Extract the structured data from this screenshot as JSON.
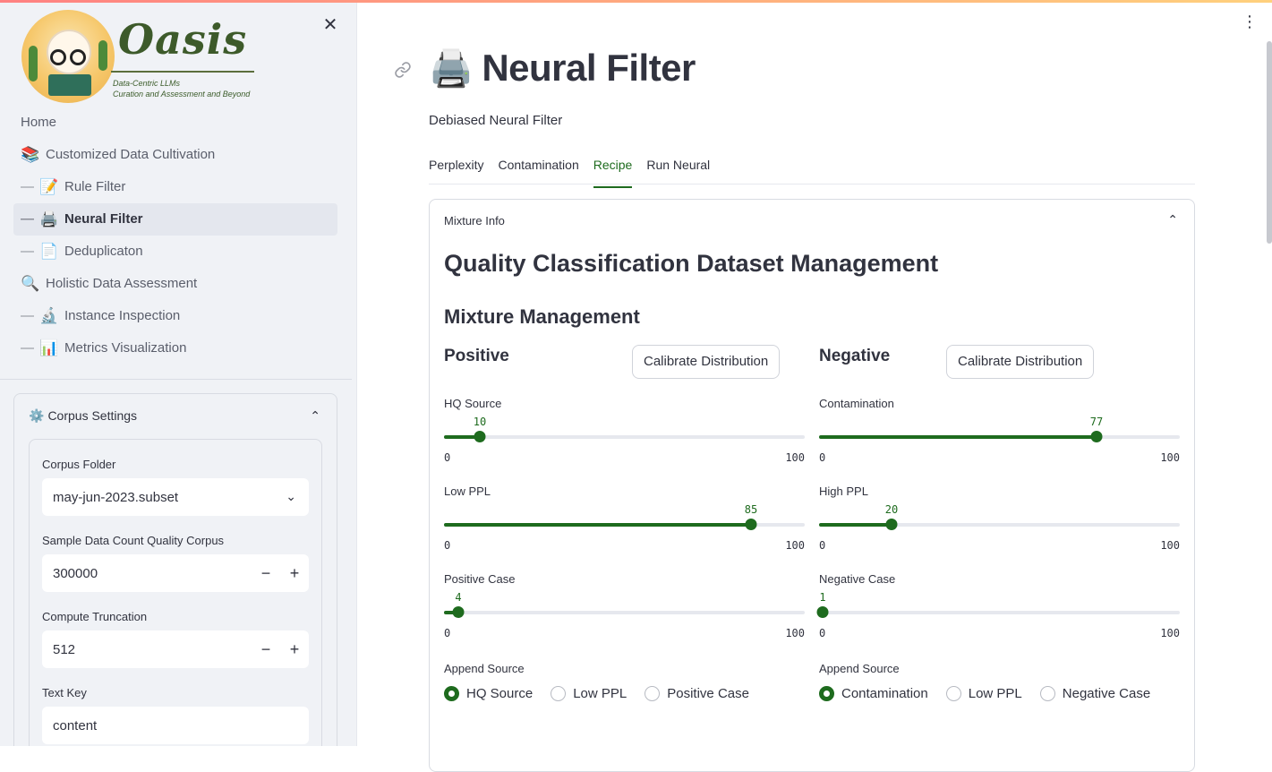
{
  "sidebar": {
    "logo": {
      "title": "Oasis",
      "subtitle_line1": "Data-Centric LLMs",
      "subtitle_line2": "Curation and Assessment and Beyond"
    },
    "close_label": "✕",
    "nav": [
      {
        "label": "Home",
        "icon": "",
        "prefix": ""
      },
      {
        "label": "Customized Data Cultivation",
        "icon": "📚",
        "prefix": ""
      },
      {
        "label": "Rule Filter",
        "icon": "📝",
        "prefix": "—"
      },
      {
        "label": "Neural Filter",
        "icon": "🖨️",
        "prefix": "—"
      },
      {
        "label": "Deduplicaton",
        "icon": "📄",
        "prefix": "—"
      },
      {
        "label": "Holistic Data Assessment",
        "icon": "🔍",
        "prefix": ""
      },
      {
        "label": "Instance Inspection",
        "icon": "🔬",
        "prefix": "—"
      },
      {
        "label": "Metrics Visualization",
        "icon": "📊",
        "prefix": "—"
      }
    ],
    "corpus_settings": {
      "icon": "⚙️",
      "title": "Corpus Settings",
      "folder_label": "Corpus Folder",
      "folder_value": "may-jun-2023.subset",
      "sample_label": "Sample Data Count Quality Corpus",
      "sample_value": "300000",
      "trunc_label": "Compute Truncation",
      "trunc_value": "512",
      "textkey_label": "Text Key",
      "textkey_value": "content"
    }
  },
  "main": {
    "title_icon": "🖨️",
    "title": "Neural Filter",
    "caption": "Debiased Neural Filter",
    "tabs": [
      "Perplexity",
      "Contamination",
      "Recipe",
      "Run Neural"
    ],
    "active_tab": "Recipe",
    "expander_title": "Mixture Info",
    "h2": "Quality Classification Dataset Management",
    "h3": "Mixture Management",
    "calibrate_label": "Calibrate Distribution",
    "positive": {
      "title": "Positive",
      "sliders": [
        {
          "label": "HQ Source",
          "value": 10,
          "min": 0,
          "max": 100
        },
        {
          "label": "Low PPL",
          "value": 85,
          "min": 0,
          "max": 100
        },
        {
          "label": "Positive Case",
          "value": 4,
          "min": 0,
          "max": 100
        }
      ],
      "radio_label": "Append Source",
      "radio_options": [
        "HQ Source",
        "Low PPL",
        "Positive Case"
      ],
      "radio_selected": 0
    },
    "negative": {
      "title": "Negative",
      "sliders": [
        {
          "label": "Contamination",
          "value": 77,
          "min": 0,
          "max": 100
        },
        {
          "label": "High PPL",
          "value": 20,
          "min": 0,
          "max": 100
        },
        {
          "label": "Negative Case",
          "value": 1,
          "min": 0,
          "max": 100
        }
      ],
      "radio_label": "Append Source",
      "radio_options": [
        "Contamination",
        "Low PPL",
        "Negative Case"
      ],
      "radio_selected": 0
    }
  },
  "colors": {
    "accent": "#1e6b1e",
    "sidebar_bg": "#f0f2f6",
    "text": "#31333f"
  }
}
